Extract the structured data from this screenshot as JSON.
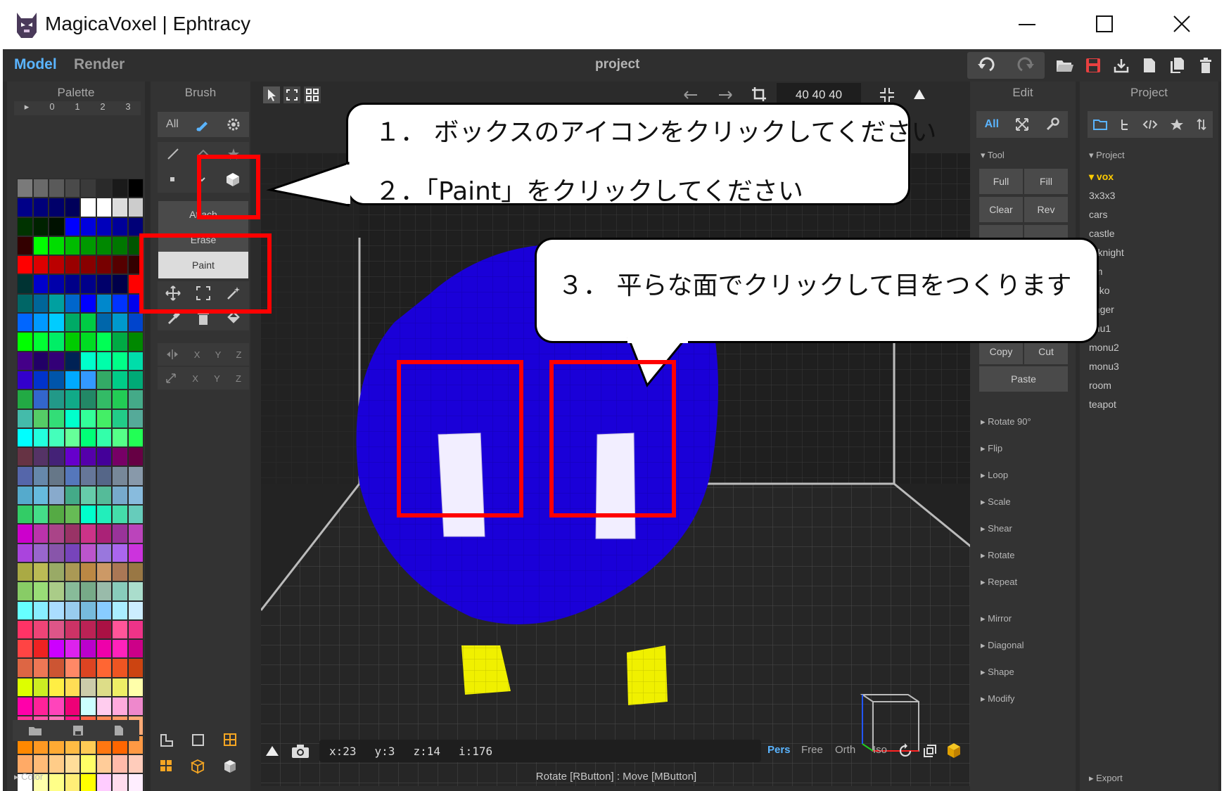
{
  "window": {
    "title": "MagicaVoxel | Ephtracy",
    "min_glyph": "—",
    "max_glyph": "☐",
    "close_glyph": "✕"
  },
  "menubar": {
    "tabs": [
      "Model",
      "Render"
    ],
    "project_title": "project"
  },
  "palette": {
    "title": "Palette",
    "page_tabs": [
      "▸",
      "0",
      "1",
      "2",
      "3"
    ],
    "footer_label": "▸ Color",
    "colors": [
      [
        "#7a7a7a",
        "#6a6a6a",
        "#5a5a5a",
        "#4a4a4a",
        "#3a3a3a",
        "#2a2a2a",
        "#1a1a1a",
        "#000000"
      ],
      [
        "#000088",
        "#00007a",
        "#00006a",
        "#00005a",
        "#ffffff",
        "#ffffff",
        "#dddddd",
        "#cccccc"
      ],
      [
        "#003300",
        "#002200",
        "#001100",
        "#0000ff",
        "#0000dd",
        "#0000bb",
        "#000099",
        "#000077"
      ],
      [
        "#330000",
        "#00ff00",
        "#00dd00",
        "#00bb00",
        "#009900",
        "#008800",
        "#007700",
        "#005500"
      ],
      [
        "#ff0000",
        "#dd0000",
        "#bb0000",
        "#990000",
        "#880000",
        "#770000",
        "#550000",
        "#330000"
      ],
      [
        "#003333",
        "#0000cc",
        "#0000aa",
        "#000088",
        "#00008a",
        "#00006a",
        "#00004a",
        "#ff0000"
      ],
      [
        "#006666",
        "#006699",
        "#00a0a0",
        "#0066cc",
        "#0000ff",
        "#0088cc",
        "#0033ff",
        "#0000ee"
      ],
      [
        "#0066ff",
        "#0099ff",
        "#00ccff",
        "#00aa66",
        "#00cc44",
        "#0066aa",
        "#0099cc",
        "#0044cc"
      ],
      [
        "#00ff00",
        "#00ff33",
        "#00ee66",
        "#00cc00",
        "#00dd22",
        "#00ff55",
        "#00aa44",
        "#008800"
      ],
      [
        "#440088",
        "#220066",
        "#330077",
        "#002255",
        "#00ffcc",
        "#00ffaa",
        "#00ff88",
        "#00ddaa"
      ],
      [
        "#3300cc",
        "#0033cc",
        "#0055aa",
        "#00aaff",
        "#3399ff",
        "#33aa66",
        "#00cc88",
        "#00aa77"
      ],
      [
        "#22aa44",
        "#3366cc",
        "#229988",
        "#11aa88",
        "#228866",
        "#33bb66",
        "#22cc55",
        "#44aa88"
      ],
      [
        "#44bbaa",
        "#55cc66",
        "#33dd77",
        "#00ffcc",
        "#33ff99",
        "#44ee66",
        "#22cc88",
        "#55aa99"
      ],
      [
        "#00ffff",
        "#22ffdd",
        "#44ffbb",
        "#66ff99",
        "#00ff77",
        "#33ffaa",
        "#55ff88",
        "#22ff55"
      ],
      [
        "#663344",
        "#553366",
        "#442277",
        "#6600cc",
        "#5500aa",
        "#440099",
        "#770066",
        "#660044"
      ],
      [
        "#5566aa",
        "#6688aa",
        "#667788",
        "#5577bb",
        "#667799",
        "#556688",
        "#778899",
        "#8899aa"
      ],
      [
        "#55aacc",
        "#66bbdd",
        "#88aacc",
        "#44aa88",
        "#66ccaa",
        "#55bb99",
        "#77aacc",
        "#88bbdd"
      ],
      [
        "#33cc66",
        "#44dd88",
        "#55aa44",
        "#66bb55",
        "#00ffcc",
        "#22eebb",
        "#44ddaa",
        "#66ccbb"
      ],
      [
        "#cc00cc",
        "#bb33aa",
        "#aa4488",
        "#993366",
        "#cc3388",
        "#aa2277",
        "#993399",
        "#bb44bb"
      ],
      [
        "#aa44dd",
        "#9966cc",
        "#8855aa",
        "#7744bb",
        "#bb55cc",
        "#9977dd",
        "#aa66ee",
        "#cc33dd"
      ],
      [
        "#aaaa44",
        "#bbbb55",
        "#99aa66",
        "#aa9955",
        "#bb8844",
        "#cc9966",
        "#aa7755",
        "#997744"
      ],
      [
        "#88cc66",
        "#99dd77",
        "#aacc88",
        "#88bb99",
        "#77aa88",
        "#99bbaa",
        "#88ccbb",
        "#aaddcc"
      ],
      [
        "#66ffff",
        "#88eeff",
        "#aaddff",
        "#99ccee",
        "#77bbdd",
        "#88ccff",
        "#aaeeff",
        "#cceeff"
      ],
      [
        "#ff3366",
        "#ee4477",
        "#dd5588",
        "#cc3366",
        "#bb2255",
        "#aa1144",
        "#ff5599",
        "#ee3388"
      ],
      [
        "#ff4444",
        "#ee2222",
        "#cc00ff",
        "#dd22ee",
        "#bb00cc",
        "#ee00aa",
        "#ff22bb",
        "#cc0088"
      ],
      [
        "#dd6644",
        "#ee7755",
        "#cc5533",
        "#ff8866",
        "#dd4422",
        "#ff6633",
        "#ee5522",
        "#cc4411"
      ],
      [
        "#ddff00",
        "#ccee22",
        "#ffee44",
        "#ffdd55",
        "#ccccaa",
        "#dddd88",
        "#eeee66",
        "#ffffaa"
      ],
      [
        "#ff00aa",
        "#ff2299",
        "#ff44bb",
        "#ee0077",
        "#ccffff",
        "#ffccee",
        "#ffaadd",
        "#ee88cc"
      ],
      [
        "#ff3399",
        "#ff55aa",
        "#ff77bb",
        "#ff1188",
        "#ff6644",
        "#ff8855",
        "#ff9966",
        "#ffaa77"
      ],
      [
        "#ff8800",
        "#ff9922",
        "#ffaa33",
        "#ffbb44",
        "#ffcc55",
        "#ff7711",
        "#ff6600",
        "#ff9944"
      ],
      [
        "#ffaa66",
        "#ffbb77",
        "#ffcc88",
        "#ffdd99",
        "#ffff66",
        "#ffcc99",
        "#ffbbaa",
        "#ffccbb"
      ],
      [
        "#ffffff",
        "#ffffaa",
        "#ffff88",
        "#ffee77",
        "#ffff00",
        "#ffccff",
        "#ffddee",
        "#ffeeff"
      ]
    ]
  },
  "brush": {
    "title": "Brush",
    "mode_all": "All",
    "modes": [
      "Attach",
      "Erase",
      "Paint"
    ],
    "axis_labels": [
      "X",
      "Y",
      "Z"
    ]
  },
  "toolbar": {
    "size_value": "40  40  40"
  },
  "edit": {
    "title": "Edit",
    "mode_all": "All",
    "tool_section": "▾ Tool",
    "buttons": {
      "full": "Full",
      "fill": "Fill",
      "clear": "Clear",
      "rev": "Rev",
      "copy": "Copy",
      "cut": "Cut",
      "paste": "Paste"
    },
    "sections": [
      "▸ Rotate 90°",
      "▸ Flip",
      "▸ Loop",
      "▸ Scale",
      "▸ Shear",
      "▸ Rotate",
      "▸ Repeat",
      "▸ Mirror",
      "▸ Diagonal",
      "▸ Shape",
      "▸ Modify"
    ]
  },
  "project": {
    "title": "Project",
    "section": "▾ Project",
    "items": [
      "▾ vox",
      "3x3x3",
      "cars",
      "castle",
      "r_knight",
      "om",
      "yoko",
      "enger",
      "onu1",
      "monu2",
      "monu3",
      "room",
      "teapot"
    ],
    "export_label": "▸ Export"
  },
  "statusbar": {
    "x": "x:23",
    "y": "y:3",
    "z": "z:14",
    "i": "i:176",
    "view_modes": [
      "Pers",
      "Free",
      "Orth",
      "Iso"
    ],
    "hint": "Rotate [RButton] : Move [MButton]"
  },
  "callouts": {
    "step1": "１． ボックスのアイコンをクリックしてください",
    "step2": "２．「Paint」をクリックしてください",
    "step3": "３． 平らな面でクリックして目をつくります"
  },
  "colors": {
    "accent_blue": "#5ab4ff",
    "save_red": "#e84040",
    "voxel_blue": "#1a00d8",
    "voxel_yellow": "#f0f000",
    "highlight_red": "#ff0000",
    "selected_project": "#ffcc00"
  }
}
